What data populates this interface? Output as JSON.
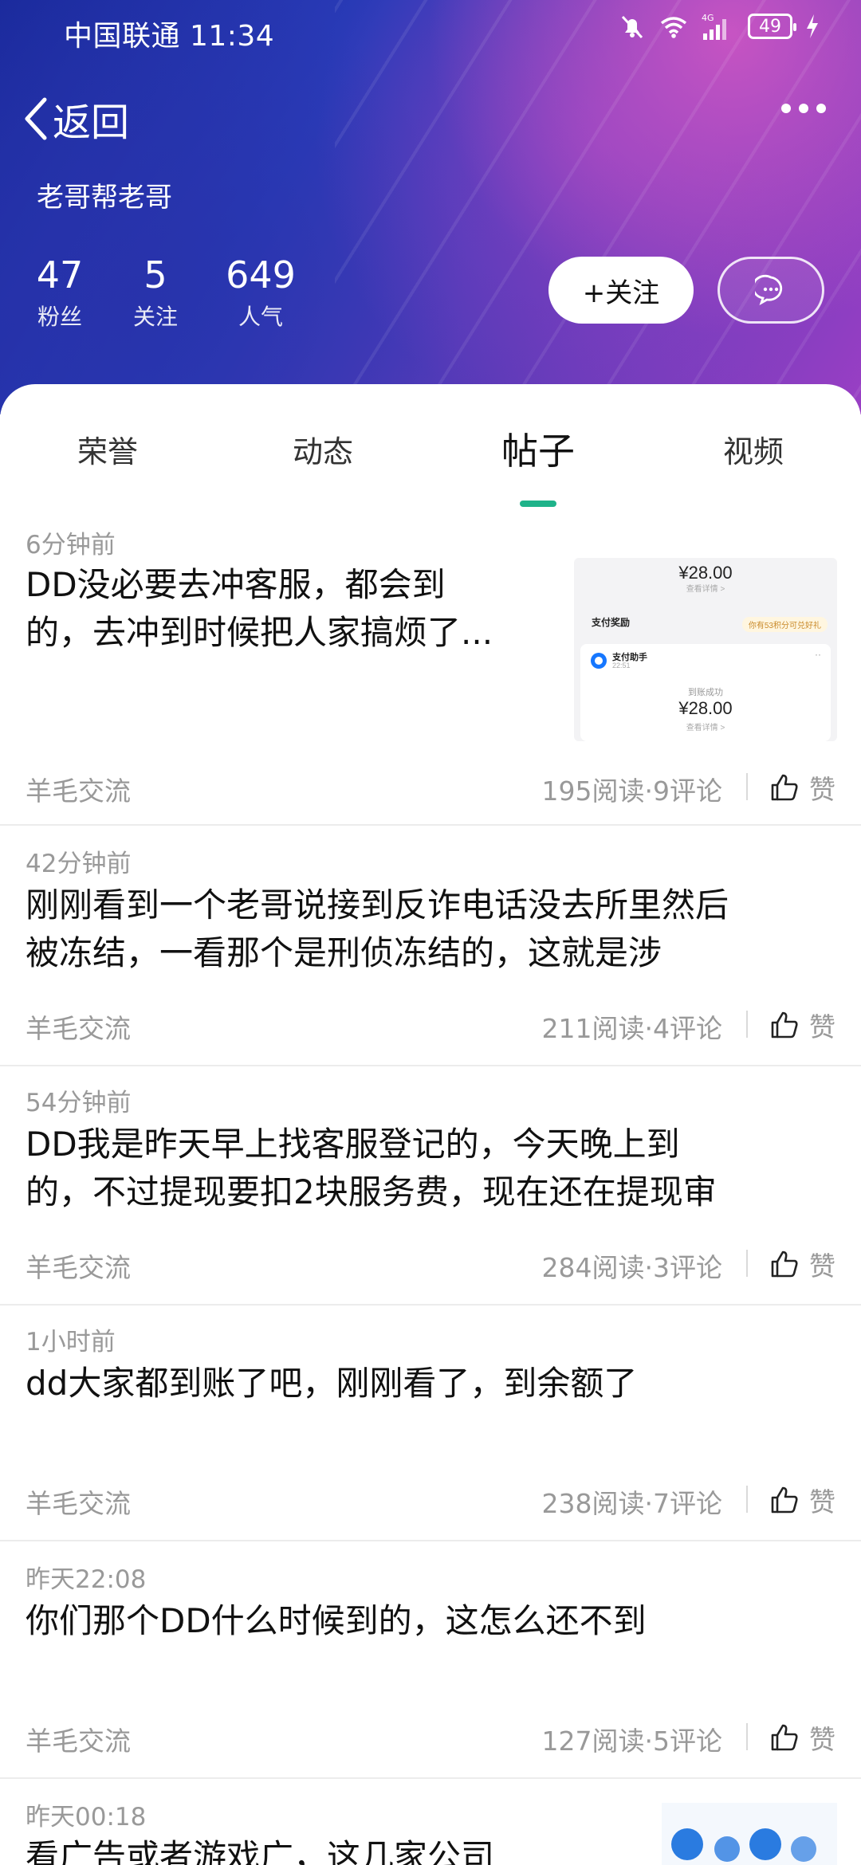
{
  "status_bar": {
    "carrier_time": "中国联通 11:34",
    "network": "4G",
    "battery": "49"
  },
  "nav": {
    "back_label": "返回"
  },
  "profile": {
    "name": "老哥帮老哥",
    "stats": [
      {
        "value": "47",
        "label": "粉丝"
      },
      {
        "value": "5",
        "label": "关注"
      },
      {
        "value": "649",
        "label": "人气"
      }
    ],
    "follow_label": "+关注"
  },
  "tabs": [
    {
      "label": "荣誉",
      "active": false
    },
    {
      "label": "动态",
      "active": false
    },
    {
      "label": "帖子",
      "active": true
    },
    {
      "label": "视频",
      "active": false
    }
  ],
  "posts": [
    {
      "time": "6分钟前",
      "title_line1": "DD没必要去冲客服，都会到",
      "title_line2": "的，去冲到时候把人家搞烦了...",
      "topic": "羊毛交流",
      "meta": "195阅读·9评论",
      "like": "赞"
    },
    {
      "time": "42分钟前",
      "title_line1": "刚刚看到一个老哥说接到反诈电话没去所里然后",
      "title_line2": "被冻结，一看那个是刑侦冻结的，这就是涉",
      "topic": "羊毛交流",
      "meta": "211阅读·4评论",
      "like": "赞"
    },
    {
      "time": "54分钟前",
      "title_line1": "DD我是昨天早上找客服登记的，今天晚上到",
      "title_line2": "的，不过提现要扣2块服务费，现在还在提现审",
      "topic": "羊毛交流",
      "meta": "284阅读·3评论",
      "like": "赞"
    },
    {
      "time": "1小时前",
      "title_line1": "dd大家都到账了吧，刚刚看了，到余额了",
      "title_line2": "",
      "topic": "羊毛交流",
      "meta": "238阅读·7评论",
      "like": "赞"
    },
    {
      "time": "昨天22:08",
      "title_line1": "你们那个DD什么时候到的，这怎么还不到",
      "title_line2": "",
      "topic": "羊毛交流",
      "meta": "127阅读·5评论",
      "like": "赞"
    },
    {
      "time": "昨天00:18",
      "title_line1": "看广告或者游戏广，这几家公司",
      "title_line2": ""
    }
  ],
  "thumbnail": {
    "amount_top": "¥28.00",
    "view_detail": "查看详情 >",
    "reward_label": "支付奖励",
    "reward_pill": "你有53积分可兑好礼",
    "helper_label": "支付助手",
    "helper_time": "22:51",
    "arrived": "到账成功",
    "amount_bottom": "¥28.00"
  }
}
